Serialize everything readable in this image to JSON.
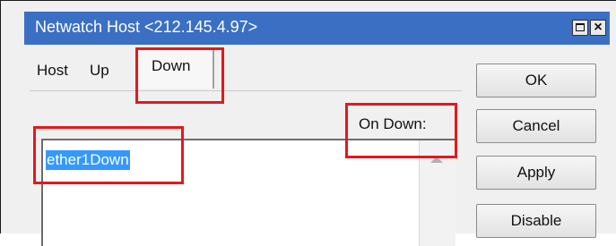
{
  "window": {
    "title": "Netwatch Host <212.145.4.97>",
    "maximize_icon": "maximize-icon",
    "close_label": "×"
  },
  "tabs": [
    {
      "label": "Host"
    },
    {
      "label": "Up"
    },
    {
      "label": "Down",
      "active": true
    }
  ],
  "down_tab": {
    "field_label": "On Down:",
    "field_value": "ether1Down"
  },
  "buttons": {
    "ok": "OK",
    "cancel": "Cancel",
    "apply": "Apply",
    "disable": "Disable"
  },
  "colors": {
    "titlebar": "#3b6fc4",
    "highlight": "#e8161b",
    "selection": "#3399ff"
  }
}
